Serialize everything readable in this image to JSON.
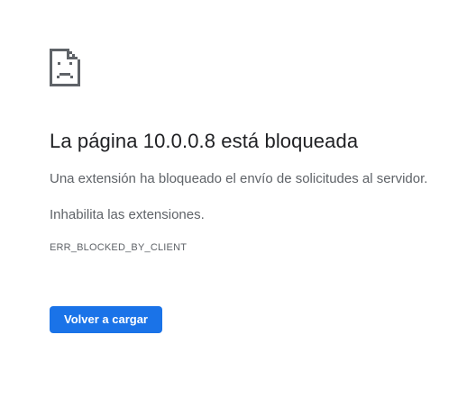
{
  "error_page": {
    "icon": "sad-document-icon",
    "title": "La página 10.0.0.8 está bloqueada",
    "message": "Una extensión ha bloqueado el envío de solicitudes al servidor.",
    "suggestion": "Inhabilita las extensiones.",
    "error_code": "ERR_BLOCKED_BY_CLIENT",
    "reload_label": "Volver a cargar"
  },
  "colors": {
    "accent": "#1a73e8",
    "title_text": "#202124",
    "body_text": "#5f6368",
    "icon": "#5f6368"
  }
}
